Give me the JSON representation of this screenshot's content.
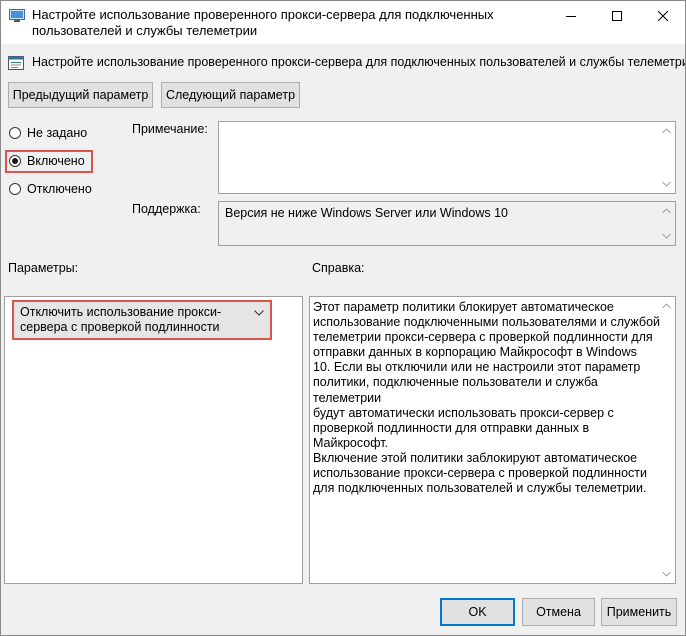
{
  "window": {
    "title": "Настройте использование проверенного прокси-сервера для подключенных пользователей и службы телеметрии"
  },
  "header": {
    "title": "Настройте использование проверенного прокси-сервера для подключенных пользователей и службы телеметрии",
    "icon": "policy-setting-icon"
  },
  "nav": {
    "previous_label": "Предыдущий параметр",
    "next_label": "Следующий параметр"
  },
  "state": {
    "options": [
      {
        "label": "Не задано",
        "checked": false
      },
      {
        "label": "Включено",
        "checked": true
      },
      {
        "label": "Отключено",
        "checked": false
      }
    ]
  },
  "comment": {
    "label": "Примечание:",
    "value": ""
  },
  "support": {
    "label": "Поддержка:",
    "value": "Версия не ниже Windows Server или Windows 10"
  },
  "options_section": {
    "label": "Параметры:",
    "selected_value": "Отключить использование прокси-сервера с проверкой подлинности"
  },
  "help_section": {
    "label": "Справка:",
    "text": "Этот параметр политики блокирует автоматическое\nиспользование подключенными пользователями и службой\nтелеметрии прокси-сервера с проверкой подлинности для\nотправки данных в корпорацию Майкрософт в Windows\n10. Если вы отключили или не настроили этот параметр\nполитики, подключенные пользователи и служба телеметрии\nбудут автоматически использовать прокси-сервер с\nпроверкой подлинности для отправки данных в Майкрософт.\nВключение этой политики заблокируют автоматическое\nиспользование прокси-сервера с проверкой подлинности\nдля подключенных пользователей и службы телеметрии."
  },
  "footer": {
    "ok_label": "OK",
    "cancel_label": "Отмена",
    "apply_label": "Применить"
  },
  "colors": {
    "highlight": "#d9534f",
    "default_button_border": "#0078d7",
    "window_background": "#f0f0f0"
  }
}
